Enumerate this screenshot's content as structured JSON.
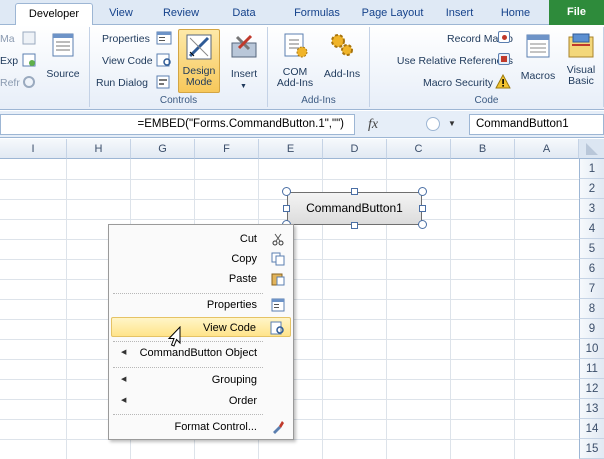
{
  "tabs": [
    {
      "label": "File"
    },
    {
      "label": "Home"
    },
    {
      "label": "Insert"
    },
    {
      "label": "Page Layout"
    },
    {
      "label": "Formulas"
    },
    {
      "label": "Data"
    },
    {
      "label": "Review"
    },
    {
      "label": "View"
    },
    {
      "label": "Developer"
    }
  ],
  "ribbon": {
    "code": {
      "group_label": "Code",
      "visual_basic": "Visual\nBasic",
      "macros": "Macros",
      "record_macro": "Record Macro",
      "use_relative": "Use Relative References",
      "macro_security": "Macro Security"
    },
    "addins": {
      "group_label": "Add-Ins",
      "addins": "Add-Ins",
      "com_addins": "COM\nAdd-Ins"
    },
    "controls": {
      "group_label": "Controls",
      "insert": "Insert",
      "design_mode": "Design\nMode",
      "properties": "Properties",
      "view_code": "View Code",
      "run_dialog": "Run Dialog"
    },
    "xml": {
      "source": "Source",
      "map_props": "Ma",
      "expansion": "Exp",
      "refresh": "Refr"
    }
  },
  "formula_bar": {
    "name_box": "CommandButton1",
    "fx": "fx",
    "formula": "=EMBED(\"Forms.CommandButton.1\",\"\")"
  },
  "columns": [
    "A",
    "B",
    "C",
    "D",
    "E",
    "F",
    "G",
    "H",
    "I"
  ],
  "rows": [
    "1",
    "2",
    "3",
    "4",
    "5",
    "6",
    "7",
    "8",
    "9",
    "10",
    "11",
    "12",
    "13",
    "14",
    "15"
  ],
  "command_button": {
    "label": "CommandButton1"
  },
  "context_menu": {
    "items": [
      {
        "label": "Cut",
        "icon": "scissors-icon"
      },
      {
        "label": "Copy",
        "icon": "copy-icon"
      },
      {
        "label": "Paste",
        "icon": "paste-icon"
      },
      {
        "label": "Properties",
        "icon": "properties-icon"
      },
      {
        "label": "View Code",
        "icon": "view-code-icon"
      },
      {
        "label": "CommandButton Object",
        "icon": ""
      },
      {
        "label": "Grouping",
        "icon": ""
      },
      {
        "label": "Order",
        "icon": ""
      },
      {
        "label": "Format Control...",
        "icon": "format-control-icon"
      }
    ]
  },
  "colors": {
    "file_tab": "#2e8b3b",
    "highlight": "#ffe48a",
    "tab_bar": "#dfe9f5"
  }
}
